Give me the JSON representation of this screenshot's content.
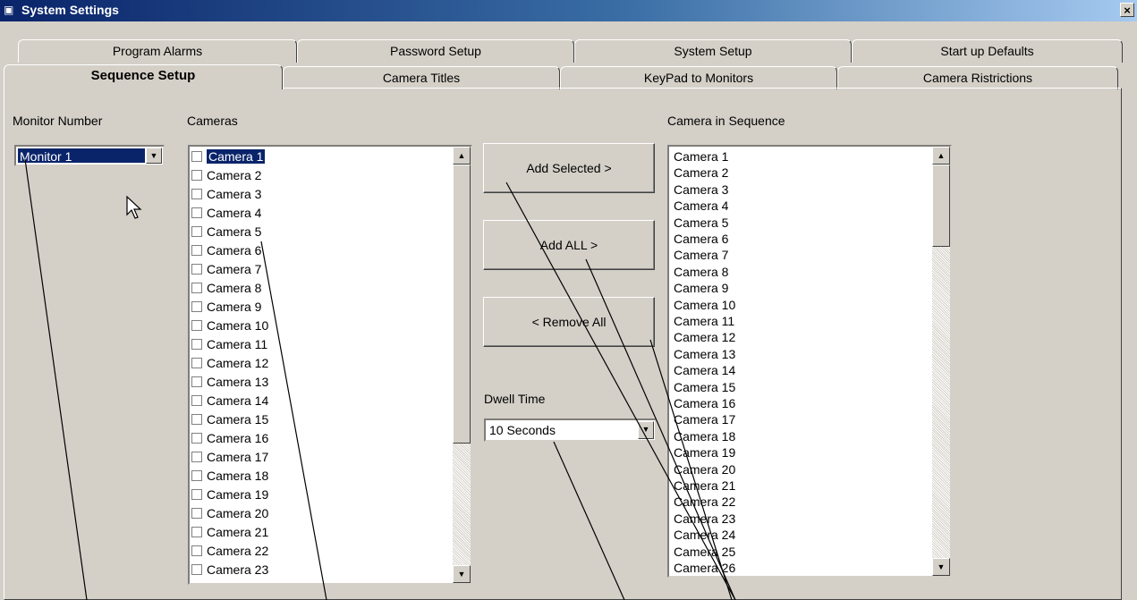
{
  "window": {
    "title": "System Settings",
    "close_glyph": "×",
    "icon": "settings-window-icon"
  },
  "tabs_back": [
    "Program Alarms",
    "Password Setup",
    "System Setup",
    "Start up Defaults"
  ],
  "tabs_front": [
    "Sequence Setup",
    "Camera Titles",
    "KeyPad to Monitors",
    "Camera Ristrictions"
  ],
  "active_tab": "Sequence Setup",
  "monitor": {
    "label": "Monitor Number",
    "value": "Monitor 1"
  },
  "cameras": {
    "label": "Cameras",
    "items": [
      "Camera 1",
      "Camera 2",
      "Camera 3",
      "Camera 4",
      "Camera 5",
      "Camera 6",
      "Camera 7",
      "Camera 8",
      "Camera 9",
      "Camera 10",
      "Camera 11",
      "Camera 12",
      "Camera 13",
      "Camera 14",
      "Camera 15",
      "Camera 16",
      "Camera 17",
      "Camera 18",
      "Camera 19",
      "Camera 20",
      "Camera 21",
      "Camera 22",
      "Camera 23"
    ],
    "selected": "Camera 1"
  },
  "buttons": {
    "add_selected": "Add Selected >",
    "add_all": "Add ALL >",
    "remove_all": "< Remove All"
  },
  "dwell": {
    "label": "Dwell Time",
    "value": "10 Seconds"
  },
  "sequence": {
    "label": "Camera in Sequence",
    "items": [
      "Camera 1",
      "Camera 2",
      "Camera 3",
      "Camera 4",
      "Camera 5",
      "Camera 6",
      "Camera 7",
      "Camera 8",
      "Camera 9",
      "Camera 10",
      "Camera 11",
      "Camera 12",
      "Camera 13",
      "Camera 14",
      "Camera 15",
      "Camera 16",
      "Camera 17",
      "Camera 18",
      "Camera 19",
      "Camera 20",
      "Camera 21",
      "Camera 22",
      "Camera 23",
      "Camera 24",
      "Camera 25",
      "Camera 26"
    ]
  },
  "colors": {
    "titlebar": "#0a246a",
    "face": "#d4d0c8",
    "selection": "#0a246a"
  }
}
